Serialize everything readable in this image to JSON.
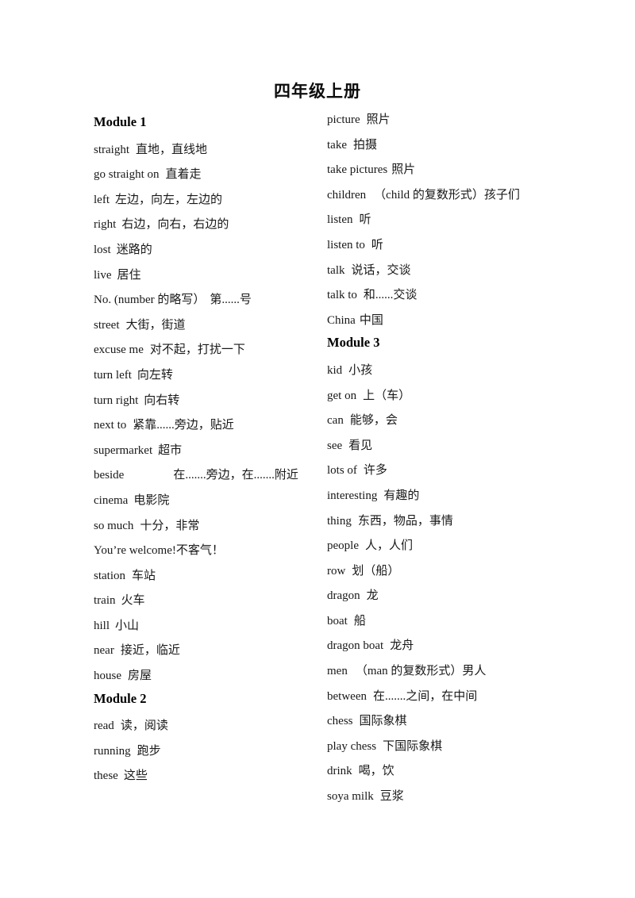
{
  "document": {
    "title": "四年级上册"
  },
  "columns": {
    "left": [
      {
        "kind": "module",
        "label": "Module 1"
      },
      {
        "kind": "entry",
        "en": "straight",
        "gap": 8,
        "zh": "直地，直线地"
      },
      {
        "kind": "entry",
        "en": "go straight on",
        "gap": 8,
        "zh": "直着走"
      },
      {
        "kind": "entry",
        "en": "left",
        "gap": 7,
        "zh": "左边，向左，左边的"
      },
      {
        "kind": "entry",
        "en": "right",
        "gap": 7,
        "zh": "右边，向右，右边的"
      },
      {
        "kind": "entry",
        "en": "lost",
        "gap": 7,
        "zh": "迷路的"
      },
      {
        "kind": "entry",
        "en": "live",
        "gap": 7,
        "zh": "居住"
      },
      {
        "kind": "entry",
        "en": "No. (number 的略写）",
        "gap": 6,
        "zh": "第......号"
      },
      {
        "kind": "entry",
        "en": "street",
        "gap": 8,
        "zh": "大街，街道"
      },
      {
        "kind": "entry",
        "en": "excuse me",
        "gap": 8,
        "zh": "对不起，打扰一下"
      },
      {
        "kind": "entry",
        "en": "turn left",
        "gap": 7,
        "zh": "向左转"
      },
      {
        "kind": "entry",
        "en": "turn right",
        "gap": 7,
        "zh": "向右转"
      },
      {
        "kind": "entry",
        "en": "next to",
        "gap": 8,
        "zh": "紧靠......旁边，贴近"
      },
      {
        "kind": "entry",
        "en": "supermarket",
        "gap": 7,
        "zh": "超市"
      },
      {
        "kind": "entry",
        "en": "beside",
        "gap": 62,
        "zh": "在.......旁边，在.......附近"
      },
      {
        "kind": "entry",
        "en": "cinema",
        "gap": 7,
        "zh": "电影院"
      },
      {
        "kind": "entry",
        "en": "so much",
        "gap": 8,
        "zh": "十分，非常"
      },
      {
        "kind": "entry",
        "en": "You’re welcome!",
        "gap": 0,
        "zh": "不客气！"
      },
      {
        "kind": "entry",
        "en": "station",
        "gap": 8,
        "zh": "车站"
      },
      {
        "kind": "entry",
        "en": "train",
        "gap": 7,
        "zh": "火车"
      },
      {
        "kind": "entry",
        "en": "hill",
        "gap": 7,
        "zh": "小山"
      },
      {
        "kind": "entry",
        "en": "near",
        "gap": 8,
        "zh": "接近，临近"
      },
      {
        "kind": "entry",
        "en": "house",
        "gap": 8,
        "zh": "房屋"
      },
      {
        "kind": "module",
        "label": "Module 2"
      },
      {
        "kind": "entry",
        "en": "read",
        "gap": 8,
        "zh": "读，阅读"
      },
      {
        "kind": "entry",
        "en": "running",
        "gap": 8,
        "zh": "跑步"
      },
      {
        "kind": "entry",
        "en": "these",
        "gap": 7,
        "zh": "这些"
      }
    ],
    "right": [
      {
        "kind": "entry",
        "en": "picture",
        "gap": 8,
        "zh": "照片"
      },
      {
        "kind": "entry",
        "en": "take",
        "gap": 8,
        "zh": "拍摄"
      },
      {
        "kind": "entry",
        "en": "take pictures",
        "gap": 5,
        "zh": "照片"
      },
      {
        "kind": "entry",
        "en": "children",
        "gap": 10,
        "zh": "（child 的复数形式）孩子们"
      },
      {
        "kind": "entry",
        "en": "listen",
        "gap": 8,
        "zh": "听"
      },
      {
        "kind": "entry",
        "en": "listen to",
        "gap": 8,
        "zh": "听"
      },
      {
        "kind": "entry",
        "en": "talk",
        "gap": 8,
        "zh": "说话，交谈"
      },
      {
        "kind": "entry",
        "en": "talk to",
        "gap": 8,
        "zh": "和......交谈"
      },
      {
        "kind": "entry",
        "en": "China",
        "gap": 5,
        "zh": "中国"
      },
      {
        "kind": "module",
        "label": "Module 3"
      },
      {
        "kind": "entry",
        "en": "kid",
        "gap": 8,
        "zh": "小孩"
      },
      {
        "kind": "entry",
        "en": "get on",
        "gap": 8,
        "zh": "上（车）"
      },
      {
        "kind": "entry",
        "en": "can",
        "gap": 8,
        "zh": "能够，会"
      },
      {
        "kind": "entry",
        "en": "see",
        "gap": 8,
        "zh": "看见"
      },
      {
        "kind": "entry",
        "en": "lots of",
        "gap": 8,
        "zh": "许多"
      },
      {
        "kind": "entry",
        "en": "interesting",
        "gap": 8,
        "zh": "有趣的"
      },
      {
        "kind": "entry",
        "en": "thing",
        "gap": 8,
        "zh": "东西，物品，事情"
      },
      {
        "kind": "entry",
        "en": "people",
        "gap": 8,
        "zh": "人，人们"
      },
      {
        "kind": "entry",
        "en": "row",
        "gap": 8,
        "zh": "划（船）"
      },
      {
        "kind": "entry",
        "en": "dragon",
        "gap": 8,
        "zh": "龙"
      },
      {
        "kind": "entry",
        "en": "boat",
        "gap": 8,
        "zh": "船"
      },
      {
        "kind": "entry",
        "en": "dragon boat",
        "gap": 8,
        "zh": "龙舟"
      },
      {
        "kind": "entry",
        "en": "men",
        "gap": 10,
        "zh": "（man 的复数形式）男人"
      },
      {
        "kind": "entry",
        "en": "between",
        "gap": 8,
        "zh": "在.......之间，在中间"
      },
      {
        "kind": "entry",
        "en": "chess",
        "gap": 8,
        "zh": "国际象棋"
      },
      {
        "kind": "entry",
        "en": "play chess",
        "gap": 8,
        "zh": "下国际象棋"
      },
      {
        "kind": "entry",
        "en": "drink",
        "gap": 8,
        "zh": "喝，饮"
      },
      {
        "kind": "entry",
        "en": "soya milk",
        "gap": 8,
        "zh": "豆浆"
      }
    ]
  }
}
